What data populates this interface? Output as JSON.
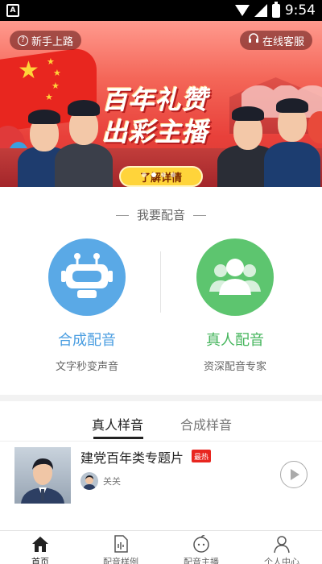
{
  "status_bar": {
    "time": "9:54",
    "app_icon": "A"
  },
  "banner": {
    "title_line1": "百年礼赞",
    "title_line2": "出彩主播",
    "cta": "了解详情",
    "left_pill": "新手上路",
    "right_pill": "在线客服",
    "dots": 4,
    "active_dot": 1
  },
  "dubbing": {
    "section_title": "我要配音",
    "cards": [
      {
        "label": "合成配音",
        "sub": "文字秒变声音",
        "color": "#4b9ee1"
      },
      {
        "label": "真人配音",
        "sub": "资深配音专家",
        "color": "#45b55c"
      }
    ]
  },
  "samples": {
    "tabs": [
      "真人样音",
      "合成样音"
    ],
    "active_tab": 0,
    "items": [
      {
        "title": "建党百年类专题片",
        "badge": "最热",
        "author": "关关"
      }
    ]
  },
  "bottom_nav": {
    "items": [
      "首页",
      "配音样例",
      "配音主播",
      "个人中心"
    ],
    "active": 0
  }
}
